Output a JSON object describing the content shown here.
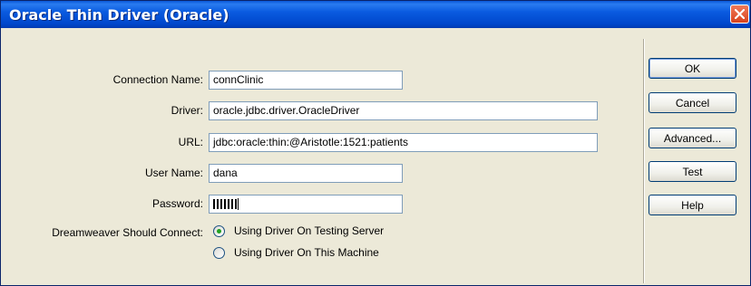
{
  "window": {
    "title": "Oracle Thin Driver (Oracle)"
  },
  "form": {
    "connection_name_label": "Connection Name:",
    "connection_name_value": "connClinic",
    "driver_label": "Driver:",
    "driver_value": "oracle.jdbc.driver.OracleDriver",
    "url_label": "URL:",
    "url_value": "jdbc:oracle:thin:@Aristotle:1521:patients",
    "username_label": "User Name:",
    "username_value": "dana",
    "password_label": "Password:",
    "connect_label": "Dreamweaver Should Connect:",
    "radio_options": [
      {
        "label": "Using Driver On Testing Server",
        "checked": true
      },
      {
        "label": "Using Driver On This Machine",
        "checked": false
      }
    ]
  },
  "buttons": {
    "ok": "OK",
    "cancel": "Cancel",
    "advanced": "Advanced...",
    "test": "Test",
    "help": "Help"
  },
  "colors": {
    "titlebar": "#0a5be0",
    "dialog_bg": "#ece9d8",
    "close_button": "#d8431e",
    "radio_dot": "#21a121"
  },
  "icons": {
    "close": "close-icon"
  }
}
